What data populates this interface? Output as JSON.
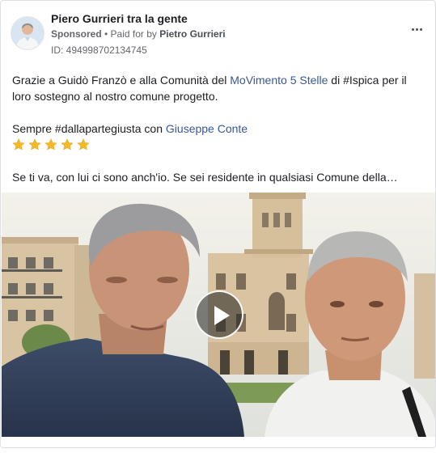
{
  "post": {
    "page_name": "Piero Gurrieri tra la gente",
    "sponsored": "Sponsored",
    "separator": " • ",
    "paid_for_by": "Paid for by ",
    "payer": "Pietro Gurrieri",
    "id_label": "ID: ",
    "id_value": "494998702134745",
    "more_icon": "more-horizontal-icon"
  },
  "body": {
    "line1_pre": "Grazie a Guidò Franzò e alla Comunità del ",
    "line1_link": "MoVimento 5 Stelle",
    "line1_post": " di #Ispica per il loro sostegno al nostro comune progetto.",
    "line2_pre": "Sempre #dallapartegiusta con ",
    "line2_link": "Giuseppe Conte",
    "stars_count": 5,
    "star_icon": "star-emoji-icon",
    "star_color": "#f7b928",
    "line3": "Se ti va, con lui ci sono anch'io. Se sei residente in qualsiasi Comune della…"
  },
  "video": {
    "play_icon": "play-icon",
    "link_color": "#385898"
  }
}
